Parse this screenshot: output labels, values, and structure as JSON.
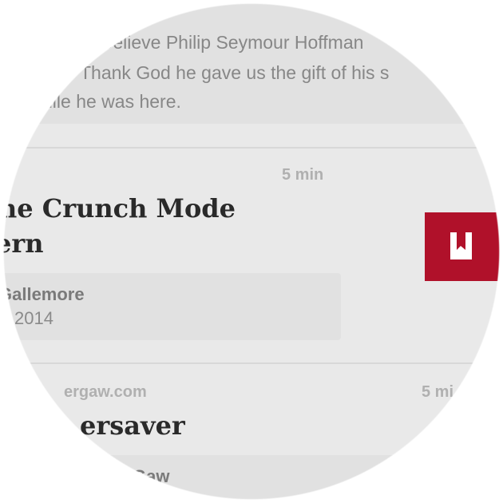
{
  "card_1": {
    "quote_lines": [
      "Believe Philip Seymour Hoffman",
      "Thank God he gave us the gift of his s",
      "hile he was here."
    ]
  },
  "card_2": {
    "read_time": "5 min",
    "title_lines": [
      "he Crunch Mode",
      "ern"
    ],
    "author": "Gallemore",
    "date": "2014"
  },
  "card_3": {
    "source": "ergaw.com",
    "read_time": "5 mi",
    "title": "ersaver",
    "author": "Gaw"
  },
  "save_action": {
    "icon": "bookmark-icon",
    "color": "#b0112a"
  }
}
